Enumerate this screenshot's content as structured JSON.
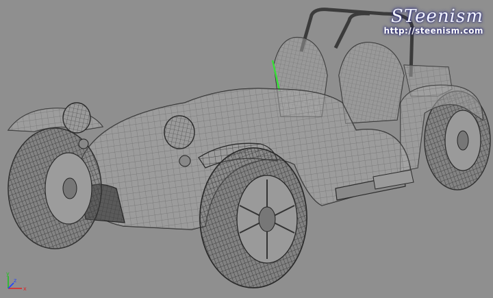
{
  "watermark": {
    "title": "STeenism",
    "url": "http://steenism.com"
  },
  "axis": {
    "x_label": "x",
    "y_label": "y",
    "z_label": "z",
    "colors": {
      "x": "#e02020",
      "y": "#20c020",
      "z": "#2040ff"
    }
  },
  "viewport": {
    "background": "#8f8f8f",
    "subject": "wireframe roadster",
    "selected_edge_color": "#37e037"
  }
}
